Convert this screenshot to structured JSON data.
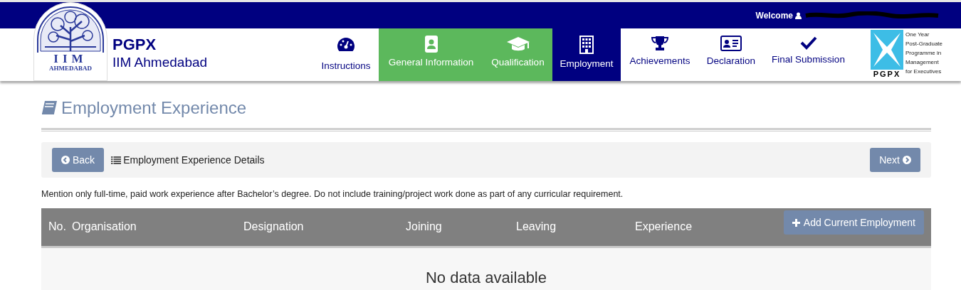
{
  "header": {
    "welcome": "Welcome",
    "brand": "PGPX",
    "institute": "IIM Ahmedabad",
    "logo_letters": "IIM",
    "logo_city": "AHMEDABAD",
    "programme_logo": {
      "mark": "PGPX",
      "tagline": [
        "One Year",
        "Post-Graduate",
        "Programme in",
        "Management",
        "for Executives"
      ]
    }
  },
  "nav": [
    {
      "label": "Instructions",
      "completed": false,
      "selected": false
    },
    {
      "label": "General Information",
      "completed": true,
      "selected": false
    },
    {
      "label": "Qualification",
      "completed": true,
      "selected": false
    },
    {
      "label": "Employment",
      "completed": false,
      "selected": true
    },
    {
      "label": "Achievements",
      "completed": false,
      "selected": false
    },
    {
      "label": "Declaration",
      "completed": false,
      "selected": false
    },
    {
      "label": "Final Submission",
      "completed": false,
      "selected": false
    }
  ],
  "page_title": "Employment Experience",
  "toolbar": {
    "back": "Back",
    "section": "Employment Experience Details",
    "next": "Next"
  },
  "note": "Mention only full-time, paid work experience after Bachelor’s degree. Do not include training/project work done as part of any curricular requirement.",
  "table": {
    "columns": [
      "No.",
      "Organisation",
      "Designation",
      "Joining",
      "Leaving",
      "Experience"
    ],
    "add_button": "Add Current Employment",
    "empty_message": "No data available"
  }
}
